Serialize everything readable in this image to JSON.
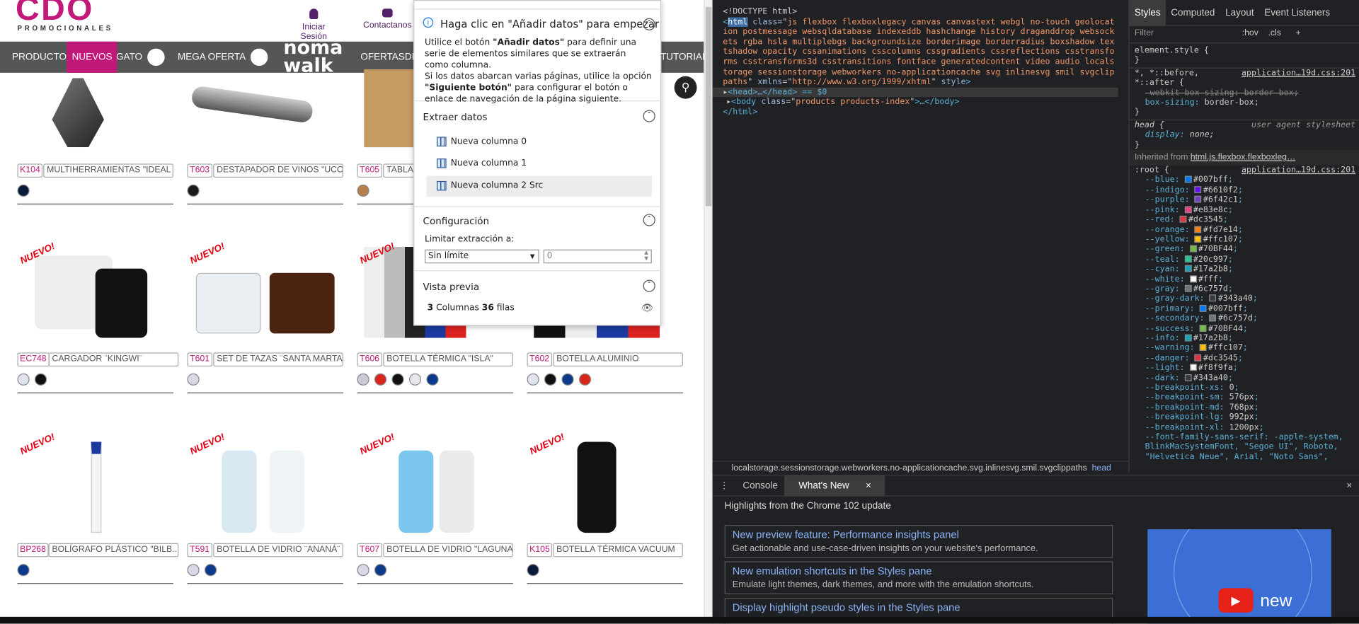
{
  "site": {
    "logo": "CDO",
    "logo_sub": "PROMOCIONALES",
    "header_links": [
      {
        "label": "Iniciar Sesión",
        "icon": "user-icon"
      },
      {
        "label": "Contactanos",
        "icon": "mail-icon"
      }
    ],
    "nav": [
      "PRODUCTOS",
      "NUEVOS",
      "GATO",
      "MEGA OFERTA",
      "OFERTAS",
      "DI",
      "TUTORIALES"
    ],
    "nav_brand": "noma walk",
    "products": [
      {
        "code": "K104",
        "name": "MULTIHERRAMIENTAS \"IDEAL ...",
        "badge": "",
        "colors": [
          "#0b1a3a"
        ]
      },
      {
        "code": "T603",
        "name": "DESTAPADOR DE VINOS \"UCO\"",
        "badge": "",
        "colors": [
          "#1c1c1c"
        ]
      },
      {
        "code": "T605",
        "name": "TABLA D",
        "badge": "",
        "colors": [
          "#b5804a"
        ]
      },
      {
        "code": "EC748",
        "name": "CARGADOR ¨KINGWI¨",
        "badge": "NUEVO!",
        "colors": [
          "#dfe2f0",
          "#111111"
        ]
      },
      {
        "code": "T601",
        "name": "SET DE TAZAS ¨SANTA MARTA¨",
        "badge": "NUEVO!",
        "colors": [
          "#d8d8e8"
        ]
      },
      {
        "code": "T606",
        "name": "BOTELLA TÉRMICA \"ISLA\"",
        "badge": "NUEVO!",
        "colors": [
          "#c9c9d8",
          "#d9261c",
          "#111111",
          "#e6e6ee",
          "#0b3a8a"
        ]
      },
      {
        "code": "T602",
        "name": "BOTELLA ALUMINIO",
        "badge": "NUEVO!",
        "colors": [
          "#dfe2f0",
          "#111111",
          "#0b3a8a",
          "#d9261c"
        ]
      },
      {
        "code": "BP268",
        "name": "BOLÍGRAFO PLÁSTICO \"BILB...",
        "badge": "NUEVO!",
        "colors": [
          "#0b3a8a"
        ]
      },
      {
        "code": "T591",
        "name": "BOTELLA DE VIDRIO ¨ANANÁ¨",
        "badge": "NUEVO!",
        "colors": [
          "#d8d8e8",
          "#0b3a8a"
        ]
      },
      {
        "code": "T607",
        "name": "BOTELLA DE VIDRIO \"LAGUNA\"",
        "badge": "NUEVO!",
        "colors": [
          "#d8d8e8",
          "#0b3a8a"
        ]
      },
      {
        "code": "K105",
        "name": "BOTELLA TÉRMICA VACUUM",
        "badge": "NUEVO!",
        "colors": [
          "#0b1a3a"
        ]
      }
    ]
  },
  "popup": {
    "header": "Haga clic en \"Añadir datos\" para empezar",
    "body_line1_a": "Utilice el botón ",
    "body_line1_b": "\"Añadir datos\"",
    "body_line1_c": " para definir una serie de elementos similares que se extraerán como columna.",
    "body_line2_a": "Si los datos abarcan varias páginas, utilice la opción ",
    "body_line2_b": "\"Siguiente botón\"",
    "body_line2_c": " para configurar el botón o enlace de navegación de la página siguiente.",
    "extract_title": "Extraer datos",
    "columns": [
      "Nueva columna 0",
      "Nueva columna 1",
      "Nueva columna 2 Src"
    ],
    "config_title": "Configuración",
    "limit_label": "Limitar extracción a:",
    "limit_select": "Sin límite",
    "limit_value": "0",
    "preview_title": "Vista previa",
    "preview_cols": "3",
    "preview_cols_label": "Columnas",
    "preview_rows": "36",
    "preview_rows_label": "filas"
  },
  "devtools": {
    "doctype": "<!DOCTYPE html>",
    "html_class": "js flexbox flexboxlegacy canvas canvastext webgl no-touch geolocation postmessage websqldatabase indexeddb hashchange history draganddrop websockets rgba hsla multiplebgs backgroundsize borderimage borderradius boxshadow textshadow opacity cssanimations csscolumns cssgradients cssreflections csstransforms csstransforms3d csstransitions fontface generatedcontent video audio localstorage sessionstorage webworkers no-applicationcache svg inlinesvg smil svgclippaths",
    "xmlns": "http://www.w3.org/1999/xhtml",
    "head_line": "<head>…</head> == $0",
    "body_class": "products products-index",
    "style_tabs": [
      "Styles",
      "Computed",
      "Layout",
      "Event Listeners"
    ],
    "filter_placeholder": "Filter",
    "hov": ":hov",
    "cls": ".cls",
    "element_style": "element.style {",
    "source": "application…19d.css:201",
    "ua_label": "user agent stylesheet",
    "inherited": "Inherited from",
    "inherited_from": "html.js.flexbox.flexboxleg…",
    "root_vars": [
      {
        "name": "--blue",
        "value": "#007bff",
        "color": "#007bff"
      },
      {
        "name": "--indigo",
        "value": "#6610f2",
        "color": "#6610f2"
      },
      {
        "name": "--purple",
        "value": "#6f42c1",
        "color": "#6f42c1"
      },
      {
        "name": "--pink",
        "value": "#e83e8c",
        "color": "#e83e8c"
      },
      {
        "name": "--red",
        "value": "#dc3545",
        "color": "#dc3545"
      },
      {
        "name": "--orange",
        "value": "#fd7e14",
        "color": "#fd7e14"
      },
      {
        "name": "--yellow",
        "value": "#ffc107",
        "color": "#ffc107"
      },
      {
        "name": "--green",
        "value": "#70BF44",
        "color": "#70BF44"
      },
      {
        "name": "--teal",
        "value": "#20c997",
        "color": "#20c997"
      },
      {
        "name": "--cyan",
        "value": "#17a2b8",
        "color": "#17a2b8"
      },
      {
        "name": "--white",
        "value": "#fff",
        "color": "#ffffff"
      },
      {
        "name": "--gray",
        "value": "#6c757d",
        "color": "#6c757d"
      },
      {
        "name": "--gray-dark",
        "value": "#343a40",
        "color": "#343a40"
      },
      {
        "name": "--primary",
        "value": "#007bff",
        "color": "#007bff"
      },
      {
        "name": "--secondary",
        "value": "#6c757d",
        "color": "#6c757d"
      },
      {
        "name": "--success",
        "value": "#70BF44",
        "color": "#70BF44"
      },
      {
        "name": "--info",
        "value": "#17a2b8",
        "color": "#17a2b8"
      },
      {
        "name": "--warning",
        "value": "#ffc107",
        "color": "#ffc107"
      },
      {
        "name": "--danger",
        "value": "#dc3545",
        "color": "#dc3545"
      },
      {
        "name": "--light",
        "value": "#f8f9fa",
        "color": "#f8f9fa"
      },
      {
        "name": "--dark",
        "value": "#343a40",
        "color": "#343a40"
      },
      {
        "name": "--breakpoint-xs",
        "value": "0",
        "color": ""
      },
      {
        "name": "--breakpoint-sm",
        "value": "576px",
        "color": ""
      },
      {
        "name": "--breakpoint-md",
        "value": "768px",
        "color": ""
      },
      {
        "name": "--breakpoint-lg",
        "value": "992px",
        "color": ""
      },
      {
        "name": "--breakpoint-xl",
        "value": "1200px",
        "color": ""
      }
    ],
    "font_family_line": "--font-family-sans-serif: -apple-system, BlinkMacSystemFont, \"Segoe UI\", Roboto, \"Helvetica Neue\", Arial, \"Noto Sans\",",
    "breadcrumb": "localstorage.sessionstorage.webworkers.no-applicationcache.svg.inlinesvg.smil.svgclippaths",
    "breadcrumb_head": "head",
    "drawer_tabs": [
      "Console",
      "What's New"
    ],
    "drawer_heading": "Highlights from the Chrome 102 update",
    "whats_new": [
      {
        "title": "New preview feature: Performance insights panel",
        "desc": "Get actionable and use-case-driven insights on your website's performance."
      },
      {
        "title": "New emulation shortcuts in the Styles pane",
        "desc": "Emulate light themes, dark themes, and more with the emulation shortcuts."
      },
      {
        "title": "Display highlight pseudo styles in the Styles pane",
        "desc": ""
      }
    ],
    "video_label": "new"
  }
}
